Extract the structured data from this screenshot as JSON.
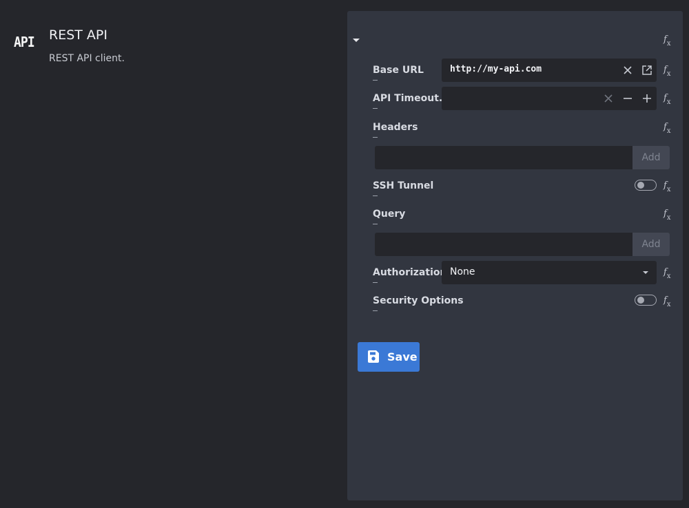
{
  "connector": {
    "logo_text": "API",
    "title": "REST API",
    "description": "REST API client."
  },
  "form": {
    "fields": {
      "base_url": {
        "label": "Base URL",
        "value": "http://my-api.com"
      },
      "api_timeout": {
        "label": "API Timeout...",
        "value": ""
      },
      "headers": {
        "label": "Headers",
        "add_label": "Add"
      },
      "ssh_tunnel": {
        "label": "SSH Tunnel",
        "enabled": false
      },
      "query": {
        "label": "Query",
        "add_label": "Add"
      },
      "authorization": {
        "label": "Authorization",
        "value": "None"
      },
      "security_options": {
        "label": "Security Options",
        "enabled": false
      }
    },
    "fx_label": "f",
    "fx_sub": "x",
    "save_label": "Save"
  },
  "colors": {
    "background": "#25262b",
    "panel": "#323640",
    "input": "#25262b",
    "accent": "#3b79d6"
  }
}
